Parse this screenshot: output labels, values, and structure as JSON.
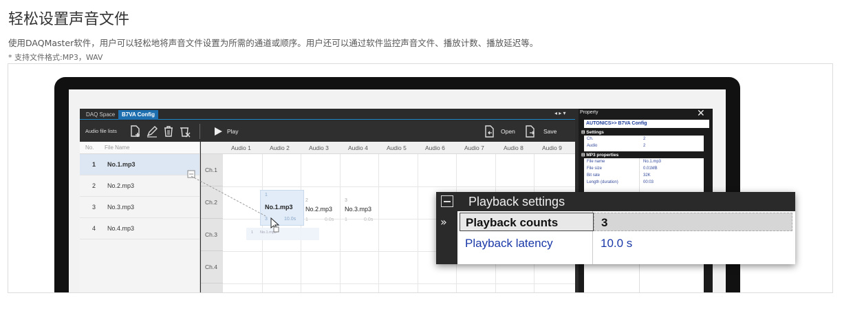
{
  "header": {
    "title": "轻松设置声音文件",
    "description": "使用DAQMaster软件，用户可以轻松地将声音文件设置为所需的通道或顺序。用户还可以通过软件监控声音文件、播放计数、播放延迟等。",
    "note": "* 支持文件格式:MP3，WAV"
  },
  "app": {
    "tabs": [
      {
        "label": "DAQ Space"
      },
      {
        "label": "B7VA Config",
        "active": true
      }
    ],
    "tab_arrows": "◂ ▸ ▾",
    "toolbar": {
      "label": "Audio file lists",
      "play_label": "Play",
      "open_label": "Open",
      "save_label": "Save"
    },
    "filelist": {
      "col_no": "No.",
      "col_name": "File Name",
      "rows": [
        {
          "no": "1",
          "name": "No.1.mp3",
          "selected": true
        },
        {
          "no": "2",
          "name": "No.2.mp3"
        },
        {
          "no": "3",
          "name": "No.3.mp3"
        },
        {
          "no": "4",
          "name": "No.4.mp3"
        }
      ]
    },
    "grid": {
      "columns": [
        "Audio 1",
        "Audio 2",
        "Audio 3",
        "Audio 4",
        "Audio 5",
        "Audio 6",
        "Audio 7",
        "Audio 8",
        "Audio 9"
      ],
      "rows": [
        "Ch.1",
        "Ch.2",
        "Ch.3",
        "Ch.4"
      ],
      "cells": [
        {
          "index": "1",
          "name": "No.1.mp3",
          "count": "3",
          "latency": "10.0s"
        },
        {
          "index": "2",
          "name": "No.2.mp3",
          "count": "1",
          "latency": "0.0s"
        },
        {
          "index": "3",
          "name": "No.3.mp3",
          "count": "1",
          "latency": "0.0s"
        }
      ],
      "ghost": {
        "index": "1",
        "name": "No.1.mp3"
      }
    },
    "property": {
      "title": "Property",
      "close": "✕",
      "path": "AUTONICS>> B7VA Config",
      "settings_label": "Settings",
      "settings": [
        {
          "key": "Ch.",
          "value": "2"
        },
        {
          "key": "Audio",
          "value": "2"
        }
      ],
      "mp3_label": "MP3 properties",
      "mp3": [
        {
          "key": "File name",
          "value": "No.1.mp3"
        },
        {
          "key": "File size",
          "value": "0.01MB"
        },
        {
          "key": "Bit rate",
          "value": "32K"
        },
        {
          "key": "Length (duration)",
          "value": "00:03"
        }
      ]
    }
  },
  "popup": {
    "title": "Playback settings",
    "arrow": "»",
    "rows": [
      {
        "label": "Playback counts",
        "value": "3"
      },
      {
        "label": "Playback latency",
        "value": "10.0 s"
      }
    ]
  }
}
